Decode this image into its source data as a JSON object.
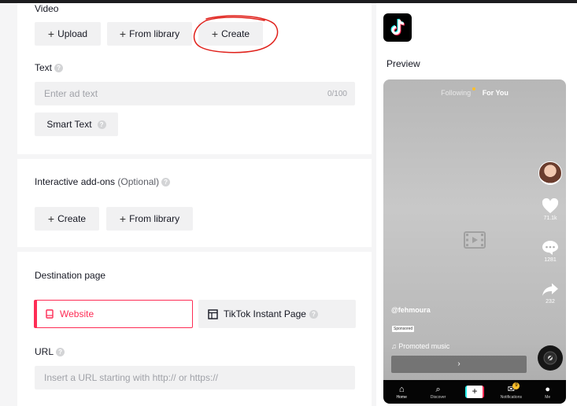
{
  "video": {
    "section_label": "Video",
    "upload_label": "Upload",
    "from_library_label": "From library",
    "create_label": "Create"
  },
  "text": {
    "section_label": "Text",
    "placeholder": "Enter ad text",
    "counter": "0/100",
    "smart_text_label": "Smart Text"
  },
  "addons": {
    "section_label": "Interactive add-ons",
    "optional_label": "(Optional)",
    "create_label": "Create",
    "from_library_label": "From library"
  },
  "destination": {
    "section_label": "Destination page",
    "website_label": "Website",
    "instant_page_label": "TikTok Instant Page",
    "url_label": "URL",
    "url_placeholder": "Insert a URL starting with http:// or https://"
  },
  "preview": {
    "label": "Preview",
    "tab_following": "Following",
    "tab_for_you": "For You",
    "likes": "71.1k",
    "comments": "1281",
    "shares": "232",
    "handle": "@fehmoura",
    "sponsored": "Sponsored",
    "music": "Promoted music",
    "cta_arrow": "›",
    "nav": {
      "home": "Home",
      "discover": "Discover",
      "notifications": "Notifications",
      "notifications_badge": "9",
      "me": "Me"
    }
  },
  "colors": {
    "accent": "#fe2c55",
    "annotation": "#e0201a"
  }
}
